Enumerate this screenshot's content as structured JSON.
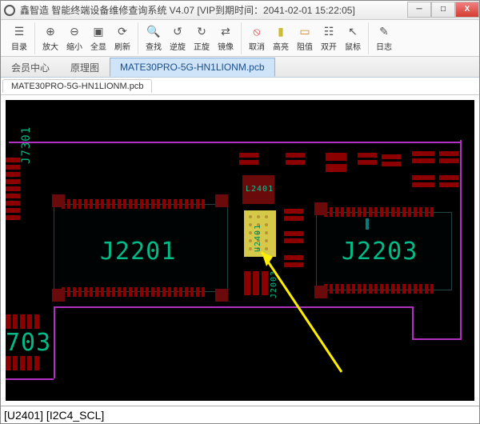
{
  "window": {
    "title": "鑫智造 智能终端设备维修查询系统 V4.07 [VIP到期时间：2041-02-01 15:22:05]"
  },
  "win_buttons": {
    "min": "─",
    "max": "□",
    "close": "X"
  },
  "toolbar": {
    "catalog": "目录",
    "zoom_in": "放大",
    "zoom_out": "缩小",
    "fit": "全显",
    "refresh": "刷新",
    "find": "查找",
    "rot_ccw": "逆旋",
    "rot_cw": "正旋",
    "mirror": "镜像",
    "cancel": "取消",
    "highlight": "高亮",
    "resist": "阻值",
    "dual": "双开",
    "cursor": "鼠标",
    "log": "日志"
  },
  "tabs": {
    "member": "会员中心",
    "schematic": "原理图",
    "pcb": "MATE30PRO-5G-HN1LIONM.pcb"
  },
  "subtab": "MATE30PRO-5G-HN1LIONM.pcb",
  "refs": {
    "j2201": "J2201",
    "j2203": "J2203",
    "r703": "703",
    "j7301": "J7301",
    "l2401": "L2401",
    "u2401": "U2401",
    "j2003": "J2003"
  },
  "status": "[U2401] [I2C4_SCL]"
}
